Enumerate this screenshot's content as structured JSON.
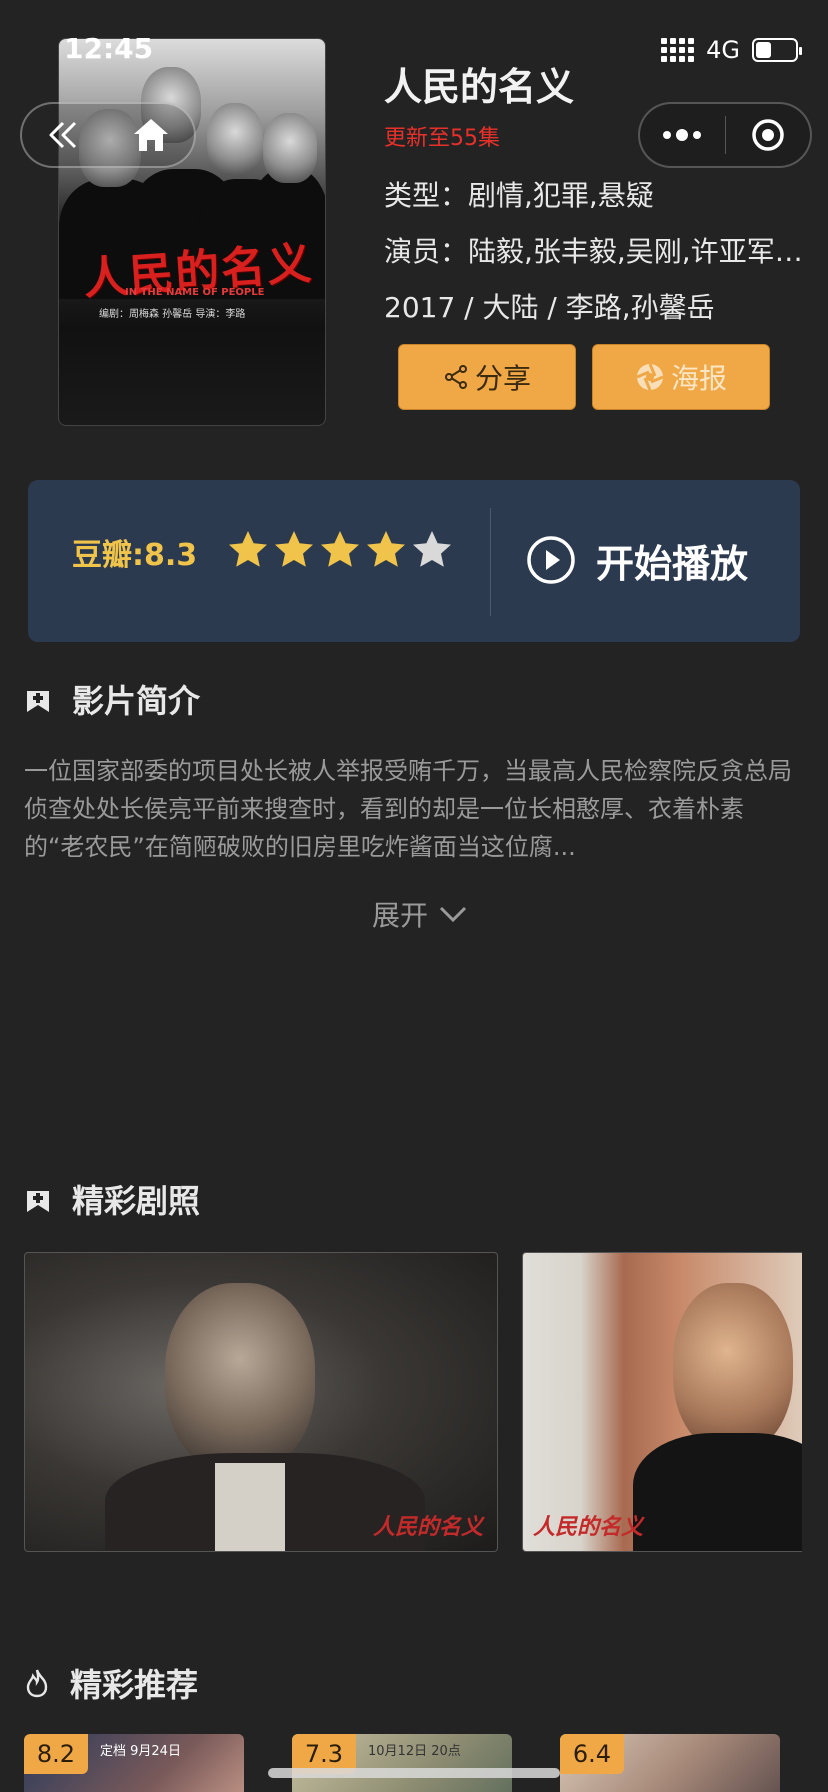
{
  "status_bar": {
    "time": "12:45",
    "network": "4G",
    "battery_level": 0.4
  },
  "movie": {
    "title": "人民的名义",
    "update_status": "更新至55集",
    "genre_line": "类型：剧情,犯罪,悬疑",
    "cast_line": "演员：陆毅,张丰毅,吴刚,许亚军,张志坚",
    "meta_line": "2017 / 大陆 / 李路,孙馨岳"
  },
  "poster": {
    "title_cn": "人民的名义",
    "title_en": "IN THE NAME OF PEOPLE",
    "credits": "编剧：周梅森  孙馨岳    导演：李路"
  },
  "actions": {
    "share_label": "分享",
    "poster_label": "海报"
  },
  "rating": {
    "label": "豆瓣:8.3",
    "value": 8.3,
    "stars_filled": 4,
    "stars_total": 5,
    "star_color": "#f0c34a",
    "star_empty_color": "#d9d9d9"
  },
  "play": {
    "label": "开始播放"
  },
  "synopsis": {
    "heading": "影片简介",
    "text": "一位国家部委的项目处长被人举报受贿千万，当最高人民检察院反贪总局侦查处处长侯亮平前来搜查时，看到的却是一位长相憨厚、衣着朴素的“老农民”在简陋破败的旧房里吃炸酱面当这位腐...",
    "expand_label": "展开"
  },
  "stills": {
    "heading": "精彩剧照",
    "watermark": "人民的名义"
  },
  "recommendations": {
    "heading": "精彩推荐",
    "items": [
      {
        "score": "8.2",
        "tag": "定档 9月24日"
      },
      {
        "score": "7.3",
        "tag": "10月12日 20点"
      },
      {
        "score": "6.4",
        "tag": ""
      }
    ]
  },
  "colors": {
    "background": "#232323",
    "accent": "#f0a846",
    "update_red": "#e8302a",
    "rating_card": "#2c3a4f"
  }
}
